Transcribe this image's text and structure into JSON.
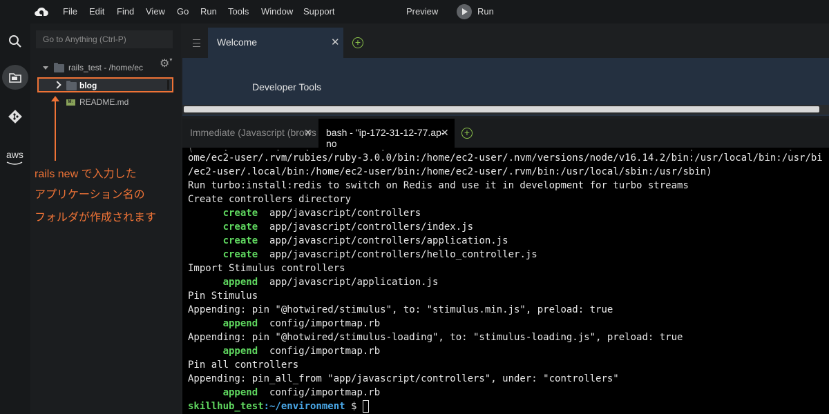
{
  "menubar": {
    "items": [
      "File",
      "Edit",
      "Find",
      "View",
      "Go",
      "Run",
      "Tools",
      "Window",
      "Support"
    ],
    "preview": "Preview",
    "run": "Run"
  },
  "activity_icons": [
    "search-icon",
    "folder-icon",
    "git-icon",
    "aws-icon"
  ],
  "aws_label": "aws",
  "sidebar": {
    "goto_placeholder": "Go to Anything (Ctrl-P)",
    "root_label": "rails_test - /home/ec",
    "selected_folder": "blog",
    "readme": "README.md",
    "md_badge": "M↓"
  },
  "annotation": {
    "lines": [
      "rails new で入力した",
      "アプリケーション名の",
      "フォルダが作成されます"
    ],
    "color": "#ef7336"
  },
  "editor": {
    "tab_title": "Welcome",
    "content": "Developer Tools"
  },
  "terminal_tabs": {
    "immediate": "Immediate (Javascript (brows",
    "bash": "bash - \"ip-172-31-12-77.ap-no"
  },
  "terminal": {
    "lines": [
      {
        "text": "ome/ec2-user/.rvm/rubies/ruby-3.0.0/bin:/home/ec2-user/.nvm/versions/node/v16.14.2/bin:/usr/local/bin:/usr/bi"
      },
      {
        "text": "/ec2-user/.local/bin:/home/ec2-user/bin:/home/ec2-user/.rvm/bin:/usr/local/sbin:/usr/sbin)"
      },
      {
        "text": "Run turbo:install:redis to switch on Redis and use it in development for turbo streams"
      },
      {
        "text": "Create controllers directory"
      },
      {
        "kw": "create",
        "text": "app/javascript/controllers"
      },
      {
        "kw": "create",
        "text": "app/javascript/controllers/index.js"
      },
      {
        "kw": "create",
        "text": "app/javascript/controllers/application.js"
      },
      {
        "kw": "create",
        "text": "app/javascript/controllers/hello_controller.js"
      },
      {
        "text": "Import Stimulus controllers"
      },
      {
        "kw": "append",
        "text": "app/javascript/application.js"
      },
      {
        "text": "Pin Stimulus"
      },
      {
        "text": "Appending: pin \"@hotwired/stimulus\", to: \"stimulus.min.js\", preload: true"
      },
      {
        "kw": "append",
        "text": "config/importmap.rb"
      },
      {
        "text": "Appending: pin \"@hotwired/stimulus-loading\", to: \"stimulus-loading.js\", preload: true"
      },
      {
        "kw": "append",
        "text": "config/importmap.rb"
      },
      {
        "text": "Pin all controllers"
      },
      {
        "text": "Appending: pin_all_from \"app/javascript/controllers\", under: \"controllers\""
      },
      {
        "kw": "append",
        "text": "config/importmap.rb"
      }
    ],
    "prompt_user": "skillhub_test",
    "prompt_path": ":~/environment",
    "prompt_symbol": "$",
    "keyword_color": "#5fd75f",
    "path_color": "#4aa8e8"
  }
}
